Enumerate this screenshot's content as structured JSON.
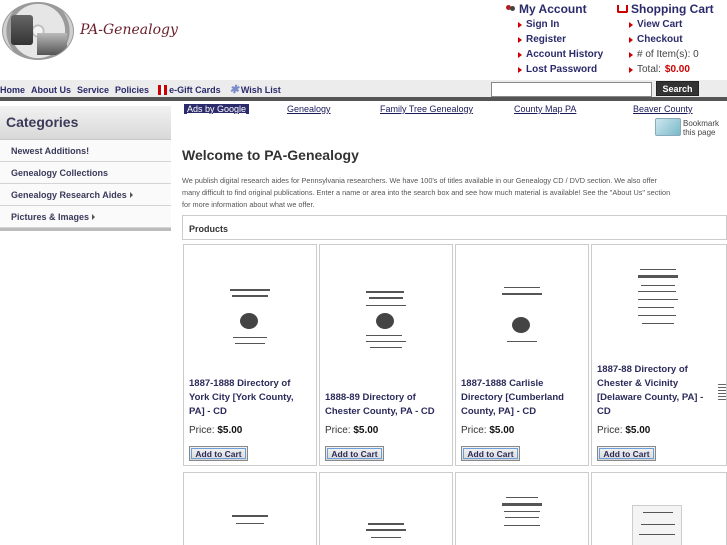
{
  "header": {
    "site_title": "PA-Genealogy",
    "account": {
      "title": "My Account",
      "links": [
        "Sign In",
        "Register",
        "Account History",
        "Lost Password"
      ]
    },
    "cart": {
      "title": "Shopping Cart",
      "links": [
        "View Cart",
        "Checkout"
      ],
      "items_label": "# of Item(s): 0",
      "total_label": "Total:",
      "total_value": "$0.00"
    }
  },
  "nav": {
    "items": [
      "Home",
      "About Us",
      "Service",
      "Policies",
      "e-Gift Cards",
      "Wish List"
    ],
    "search_button": "Search",
    "search_value": ""
  },
  "sidebar": {
    "title": "Categories",
    "items": [
      "Newest Additions!",
      "Genealogy Collections",
      "Genealogy Research Aides",
      "Pictures & Images"
    ]
  },
  "ads": {
    "label": "Ads by Google",
    "links": [
      "Genealogy",
      "Family Tree Genealogy",
      "County Map PA",
      "Beaver County"
    ]
  },
  "bookmark": {
    "line1": "Bookmark",
    "line2": "this page"
  },
  "main": {
    "title": "Welcome to PA-Genealogy",
    "intro_lines": [
      "We publish digital research aides for Pennsylvania researchers.  We have 100's of titles available in our Genealogy CD / DVD section.   We also offer",
      "many difficult to find original publications.  Enter a name or area into the search box and see how much material is available!  See the \"About Us\" section",
      "for more information about what we offer."
    ],
    "products_heading": "Products",
    "price_label": "Price:",
    "add_to_cart_label": "Add to Cart",
    "products": [
      {
        "name": "1887-1888 Directory of York City [York County, PA] - CD",
        "price": "$5.00"
      },
      {
        "name": "1888-89 Directory of Chester County, PA - CD",
        "price": "$5.00"
      },
      {
        "name": "1887-1888 Carlisle Directory [Cumberland County, PA] - CD",
        "price": "$5.00"
      },
      {
        "name": "1887-88 Directory of Chester & Vicinity [Delaware County, PA] - CD",
        "price": "$5.00"
      }
    ]
  }
}
